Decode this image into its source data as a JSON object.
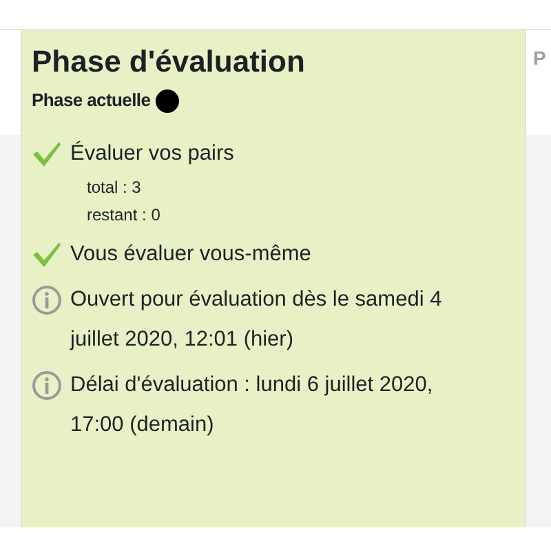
{
  "phase": {
    "title": "Phase d'évaluation",
    "status_label": "Phase actuelle",
    "current": true,
    "tasks": [
      {
        "kind": "task",
        "completed": true,
        "label": "Évaluer vos pairs",
        "details": [
          "total : 3",
          "restant : 0"
        ]
      },
      {
        "kind": "task",
        "completed": true,
        "label": "Vous évaluer vous-même"
      },
      {
        "kind": "info",
        "label": "Ouvert pour évaluation dès le samedi 4 juillet 2020, 12:01 (hier)"
      },
      {
        "kind": "info",
        "label": "Délai d'évaluation : lundi 6 juillet 2020, 17:00 (demain)"
      }
    ]
  },
  "next_phase": {
    "title": "P"
  }
}
